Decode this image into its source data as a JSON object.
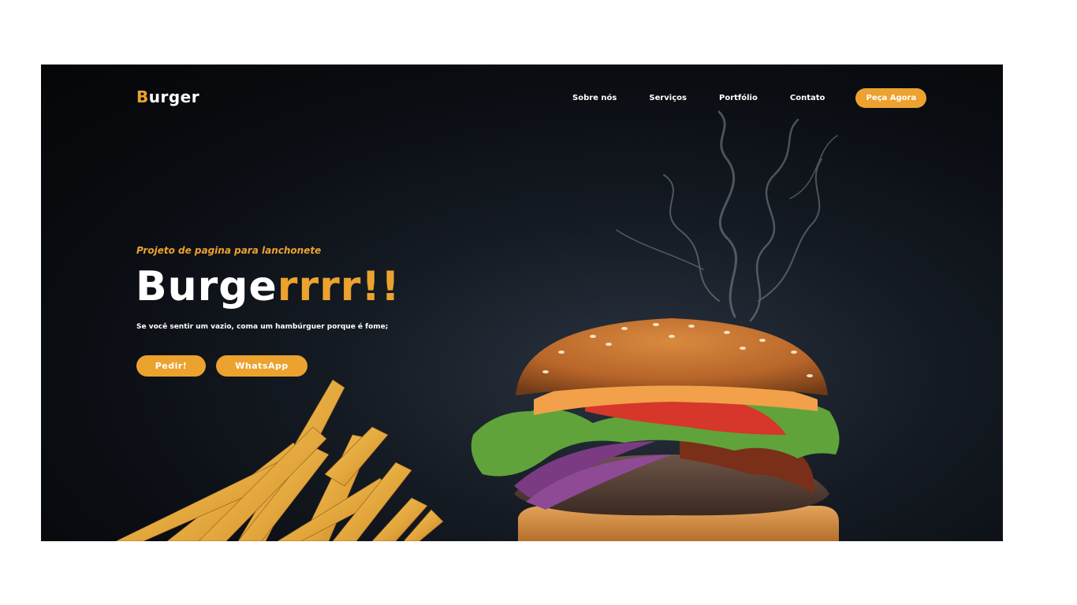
{
  "brand": {
    "logo_initial": "B",
    "logo_rest": "urger",
    "accent_color": "#eca22e"
  },
  "nav": {
    "items": [
      "Sobre nós",
      "Serviços",
      "Portfólio",
      "Contato"
    ],
    "cta_label": "Peça Agora"
  },
  "hero": {
    "subtitle": "Projeto de pagina para lanchonete",
    "headline_white": "Burge",
    "headline_orange": "rrrr!!",
    "description": "Se você sentir um vazio, coma um hambúrguer porque é fome;",
    "buttons": {
      "order_label": "Pedir!",
      "whatsapp_label": "WhatsApp"
    }
  },
  "images": {
    "burger": "burger-photo",
    "fries": "french-fries-photo",
    "smoke": "smoke-wisps"
  }
}
